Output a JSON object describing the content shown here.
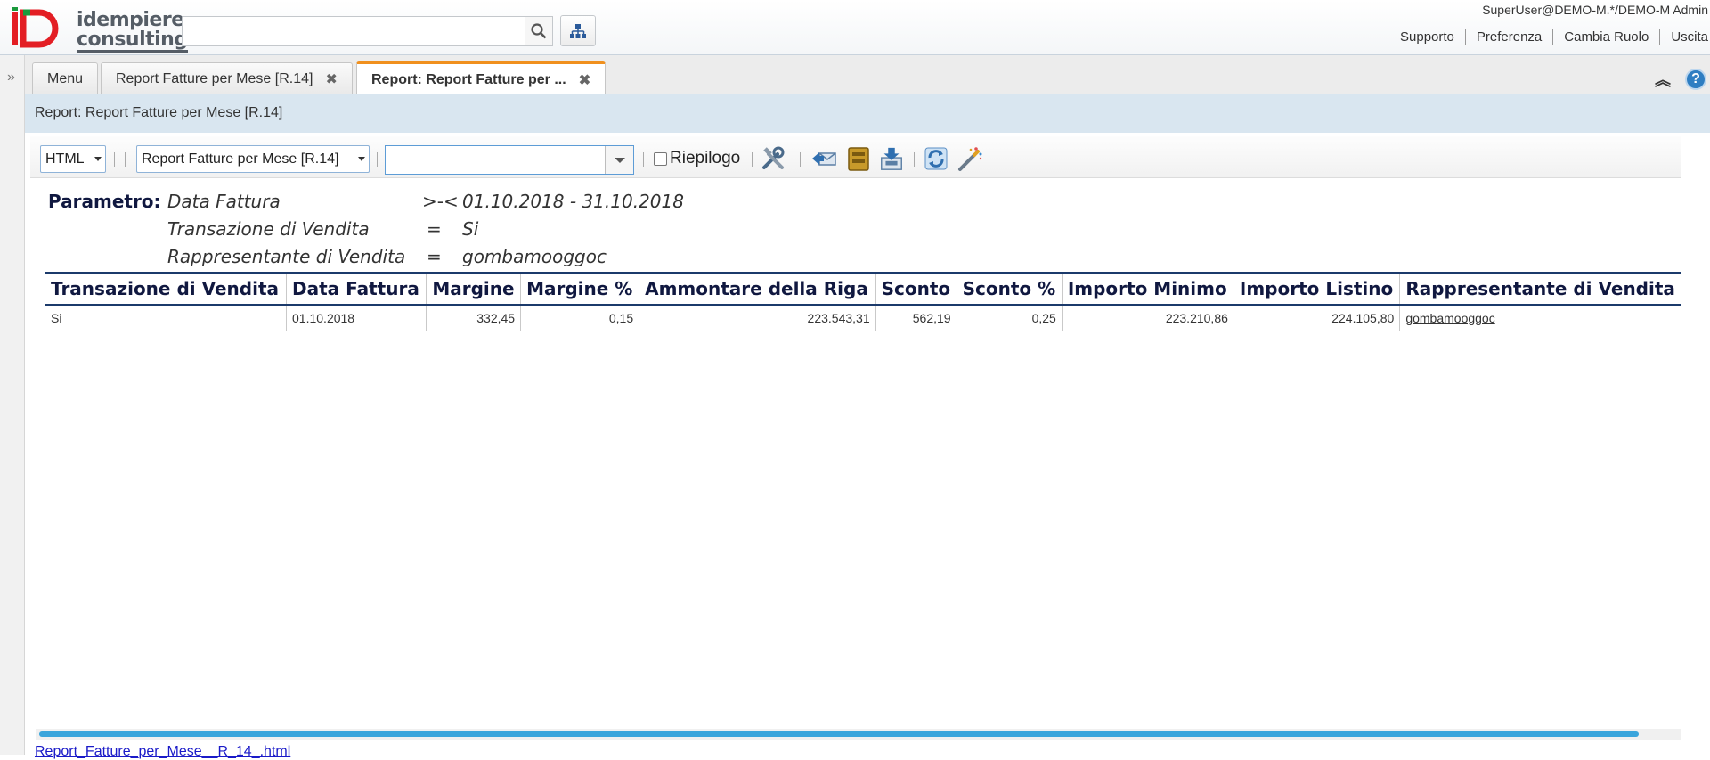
{
  "header": {
    "logo_text_line1": "idempiere",
    "logo_text_line2": "consulting",
    "search_placeholder": "",
    "user_info": "SuperUser@DEMO-M.*/DEMO-M Admin",
    "links": [
      "Supporto",
      "Preferenza",
      "Cambia Ruolo",
      "Uscita"
    ]
  },
  "tabs": [
    {
      "label": "Menu",
      "closable": false
    },
    {
      "label": "Report Fatture per Mese [R.14]",
      "closable": true
    },
    {
      "label": "Report: Report Fatture per ...",
      "closable": true,
      "selected": true
    }
  ],
  "title_bar": "Report: Report Fatture per Mese [R.14]",
  "toolbar": {
    "format_value": "HTML",
    "report_value": "Report Fatture per Mese [R.14]",
    "combo_value": "",
    "summary_label": "Riepilogo",
    "summary_checked": false,
    "icons": [
      "customize-icon",
      "send-icon",
      "archive-icon",
      "export-icon",
      "refresh-icon",
      "wizard-icon"
    ]
  },
  "report": {
    "param_label": "Parametro:",
    "params": [
      {
        "name": "Data Fattura",
        "op": ">-<",
        "value": "01.10.2018 - 31.10.2018"
      },
      {
        "name": "Transazione di Vendita",
        "op": "=",
        "value": "Si"
      },
      {
        "name": "Rappresentante di Vendita",
        "op": "=",
        "value": "gombamooggoc"
      }
    ],
    "columns": [
      "Transazione di Vendita",
      "Data Fattura",
      "Margine",
      "Margine %",
      "Ammontare della Riga",
      "Sconto",
      "Sconto %",
      "Importo Minimo",
      "Importo Listino",
      "Rappresentante di Vendita"
    ],
    "rows": [
      [
        "Si",
        "01.10.2018",
        "332,45",
        "0,15",
        "223.543,31",
        "562,19",
        "0,25",
        "223.210,86",
        "224.105,80",
        "gombamooggoc"
      ]
    ]
  },
  "footer_link": "Report_Fatture_per_Mese__R_14_.html",
  "colors": {
    "accent": "#f0901e",
    "title_bar": "#d9e6f0",
    "scroll": "#3aa5dc",
    "header_text": "#101840"
  }
}
